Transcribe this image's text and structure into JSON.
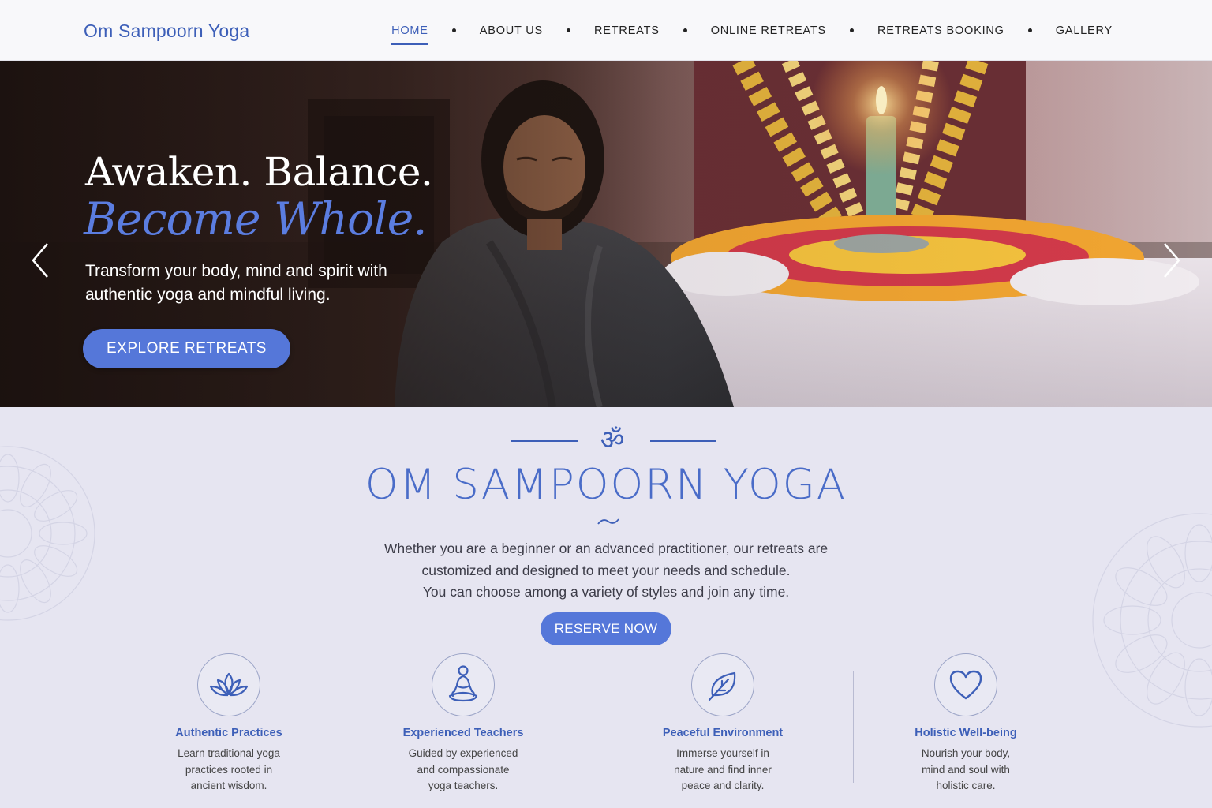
{
  "header": {
    "brand": "Om Sampoorn Yoga",
    "nav": [
      {
        "label": "HOME",
        "active": true
      },
      {
        "label": "ABOUT US",
        "active": false
      },
      {
        "label": "RETREATS",
        "active": false
      },
      {
        "label": "ONLINE RETREATS",
        "active": false
      },
      {
        "label": "RETREATS BOOKING",
        "active": false
      },
      {
        "label": "GALLERY",
        "active": false
      }
    ]
  },
  "hero": {
    "headline": "Awaken. Balance.",
    "headline_accent": "Become Whole.",
    "subtext": "Transform your body, mind and spirit with authentic yoga and mindful living.",
    "cta_label": "EXPLORE RETREATS",
    "prev_icon": "chevron-left-icon",
    "next_icon": "chevron-right-icon"
  },
  "intro": {
    "symbol": "ॐ",
    "title": "OM SAMPOORN YOGA",
    "paragraph_lines": [
      "Whether you are a beginner or an advanced practitioner, our retreats are",
      "customized and designed to meet your needs and schedule.",
      "You can choose among a variety of styles and join any time."
    ],
    "cta_label": "RESERVE NOW"
  },
  "features": [
    {
      "icon": "lotus-icon",
      "title": "Authentic Practices",
      "text": "Learn traditional yoga practices rooted in ancient wisdom."
    },
    {
      "icon": "meditation-icon",
      "title": "Experienced Teachers",
      "text": "Guided by experienced and compassionate yoga teachers."
    },
    {
      "icon": "leaf-icon",
      "title": "Peaceful Environment",
      "text": "Immerse yourself in nature and find inner peace and clarity."
    },
    {
      "icon": "heart-icon",
      "title": "Holistic Well-being",
      "text": "Nourish your body, mind and soul with holistic care."
    }
  ],
  "colors": {
    "accent": "#3d5fb8",
    "button": "#5577d9",
    "section_bg": "#e6e5f1"
  }
}
